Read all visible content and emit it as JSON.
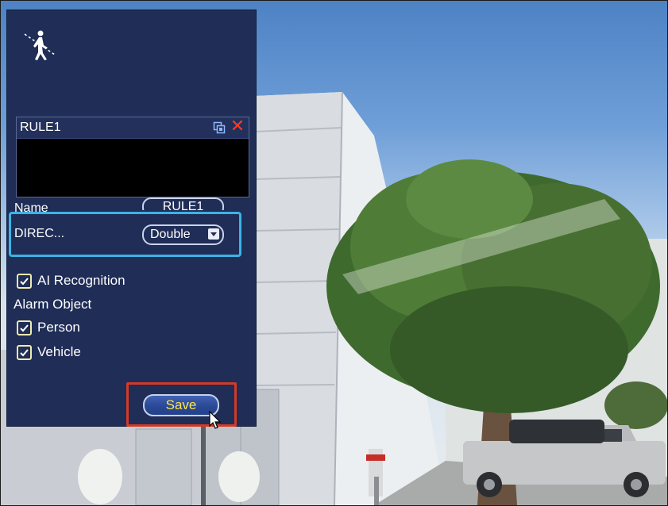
{
  "panel": {
    "rule_list": {
      "rule_name": "RULE1",
      "delete_glyph": "✕"
    },
    "name": {
      "label": "Name",
      "value": "RULE1"
    },
    "direction": {
      "label": "DIREC...",
      "value": "Double"
    },
    "ai_recognition": {
      "label": "AI Recognition",
      "checked": true
    },
    "alarm_object": {
      "label": "Alarm Object",
      "person": {
        "label": "Person",
        "checked": true
      },
      "vehicle": {
        "label": "Vehicle",
        "checked": true
      }
    },
    "save_label": "Save"
  },
  "icons": {
    "header": "tripwire-pedestrian-icon",
    "edit": "edit-copy-icon",
    "delete": "close-icon",
    "dropdown": "chevron-down-icon",
    "checkbox": "checkmark-icon",
    "cursor": "mouse-pointer-icon"
  },
  "colors": {
    "panel_bg": "#1f2d57",
    "direction_highlight": "#3ab4e4",
    "save_highlight": "#d33a26",
    "save_text": "#ffe74a",
    "delete_icon": "#ff3b1f",
    "checkbox_border": "#f1ebb0"
  }
}
